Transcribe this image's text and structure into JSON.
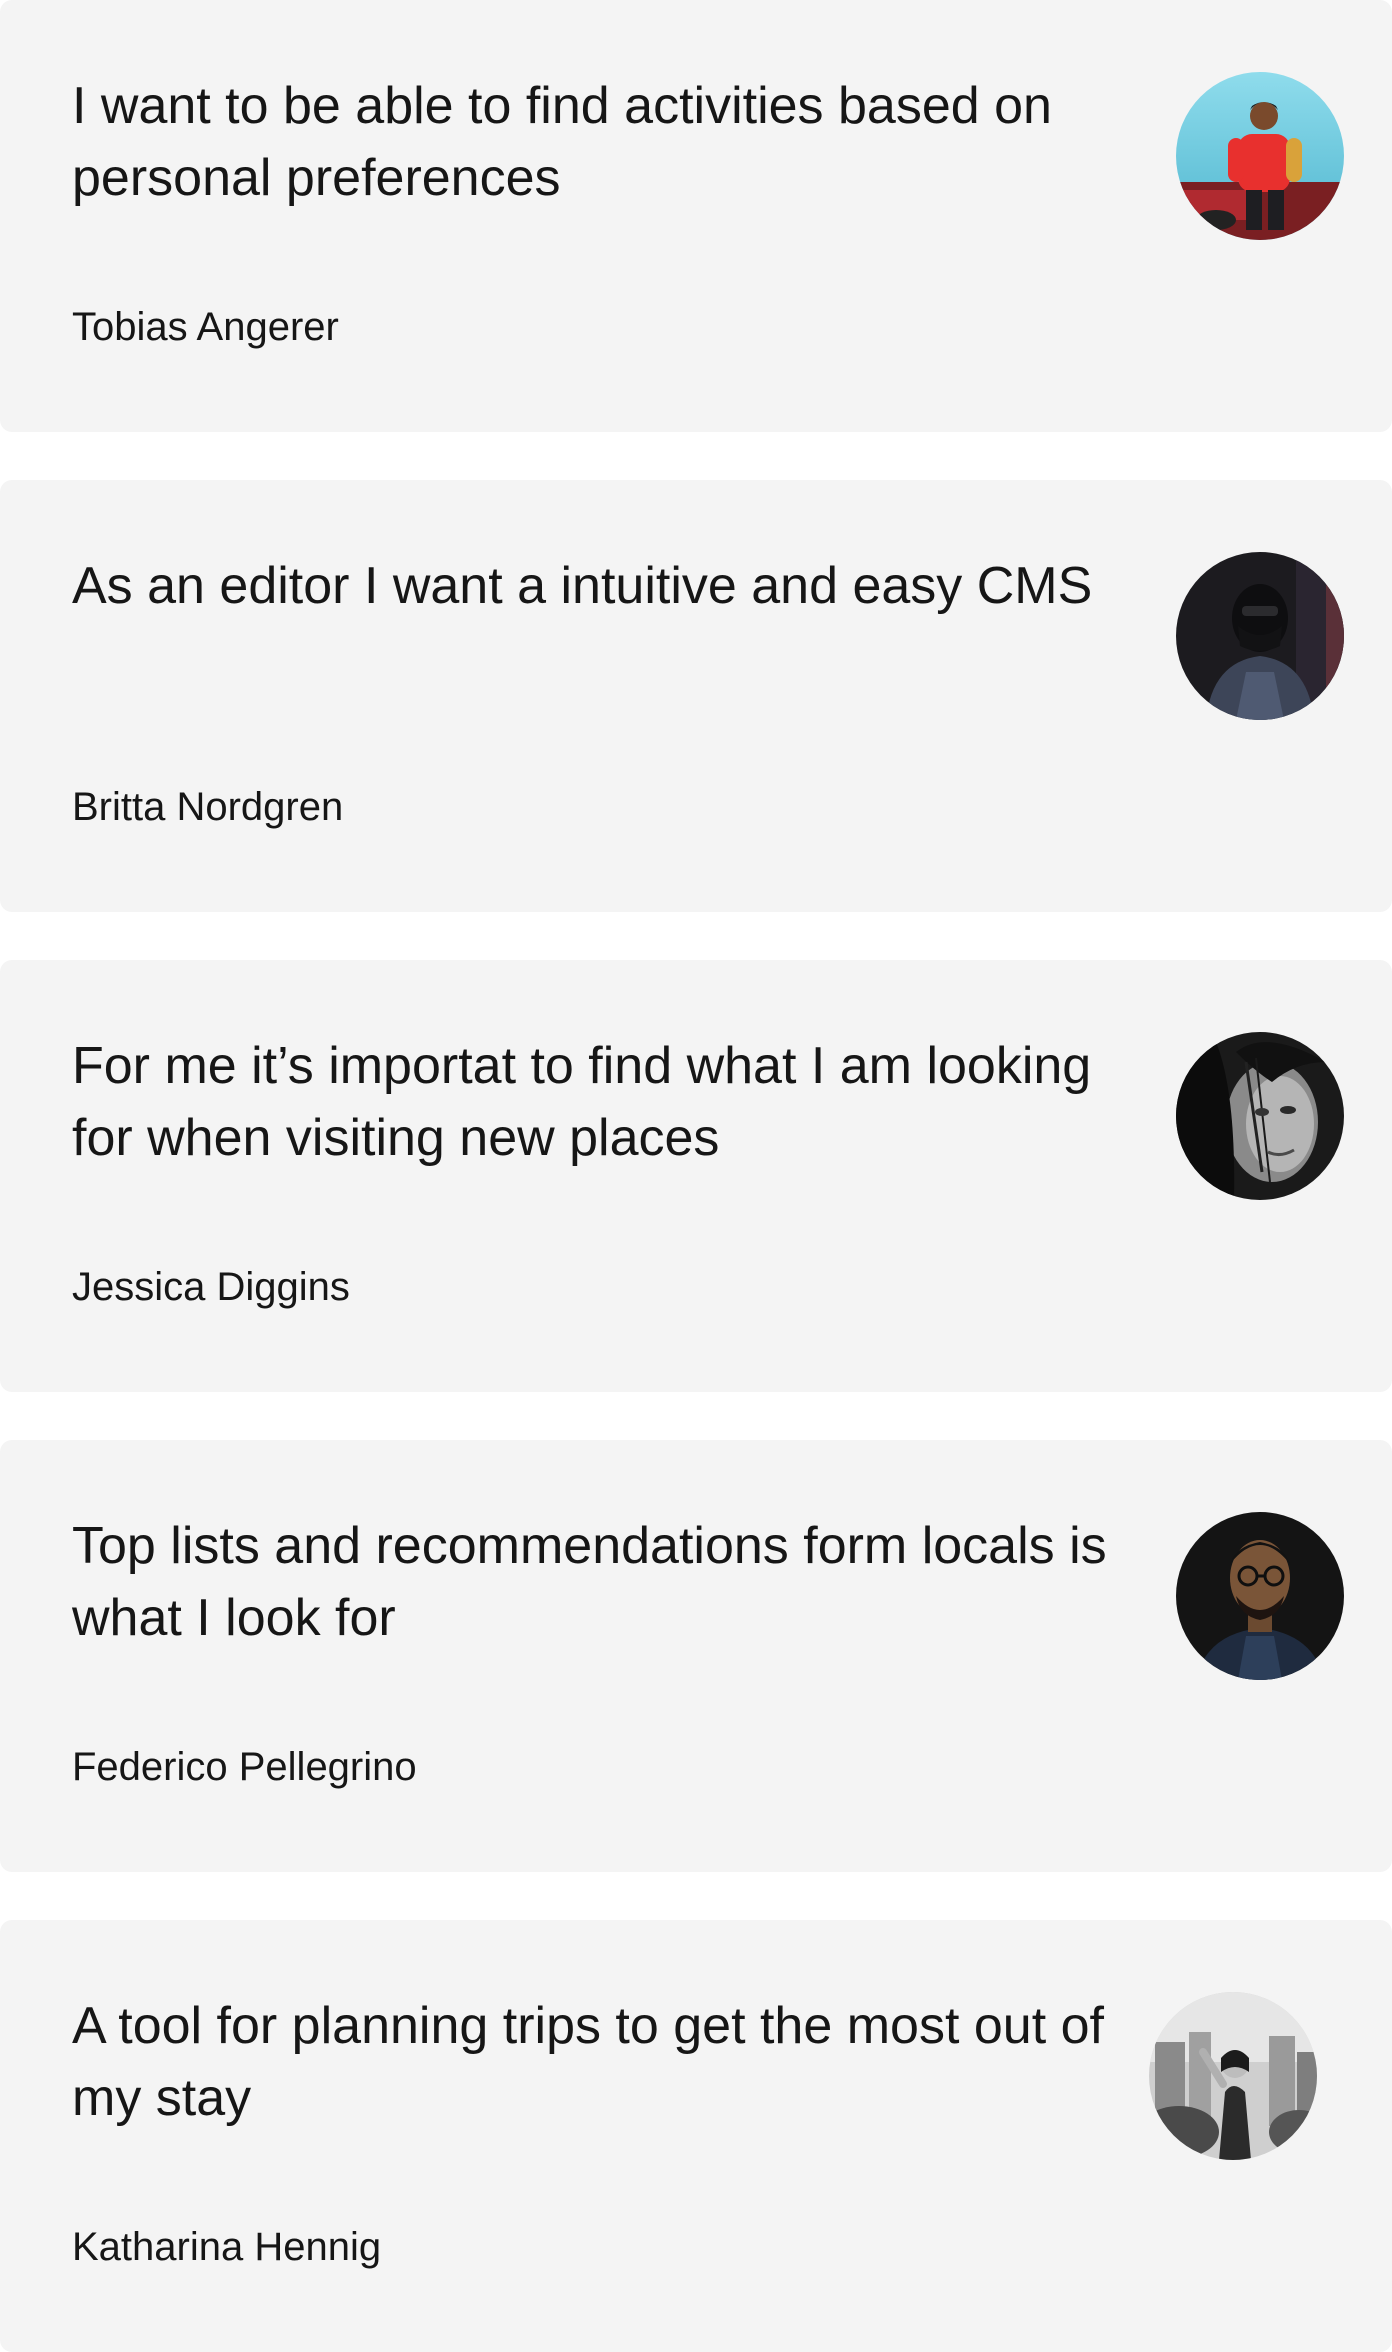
{
  "testimonials": [
    {
      "quote": "I want to be able to find activities based on personal preferences",
      "author": "Tobias Angerer",
      "avatar": "avatar-person-red-hoodie"
    },
    {
      "quote": "As an editor I want a intuitive and easy CMS",
      "author": "Britta Nordgren",
      "avatar": "avatar-person-masked-dark"
    },
    {
      "quote": "For me it’s importat to find what I am looking for when visiting new places",
      "author": "Jessica Diggins",
      "avatar": "avatar-woman-bw-portrait"
    },
    {
      "quote": "Top lists and recommendations form locals is what I look for",
      "author": "Federico Pellegrino",
      "avatar": "avatar-man-glasses-dark"
    },
    {
      "quote": "A tool for planning trips to get the most out of my stay",
      "author": "Katharina Hennig",
      "avatar": "avatar-woman-city-bw"
    }
  ],
  "colors": {
    "card_background": "#f4f4f4",
    "page_background": "#ffffff",
    "text": "#161616"
  }
}
